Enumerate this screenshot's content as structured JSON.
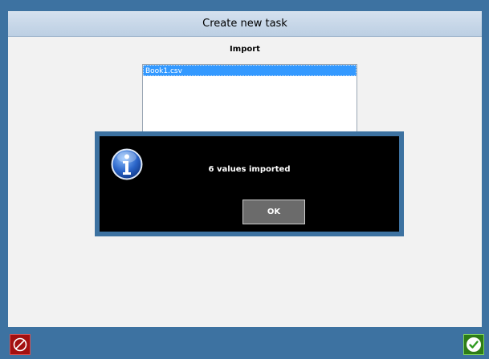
{
  "window": {
    "title": "Create new task"
  },
  "import": {
    "label": "Import",
    "files": [
      "Book1.csv"
    ]
  },
  "modal": {
    "icon": "info-icon",
    "message": "6 values imported",
    "ok_label": "OK"
  },
  "footer": {
    "cancel_icon": "prohibited-icon",
    "confirm_icon": "checkmark-icon"
  },
  "colors": {
    "frame": "#3d72a1",
    "selection": "#3399ff",
    "modal_bg": "#000000",
    "cancel": "#a31010",
    "confirm": "#2e7d17"
  }
}
